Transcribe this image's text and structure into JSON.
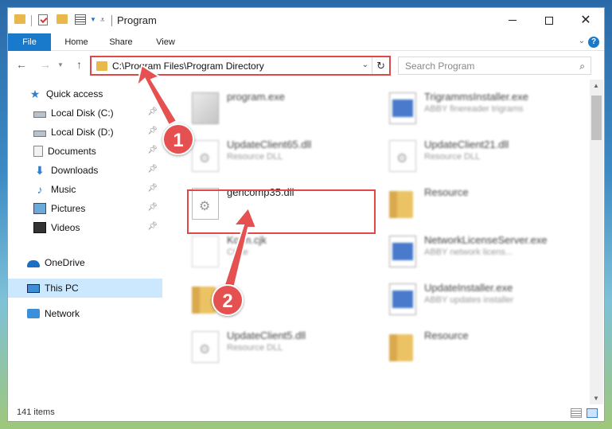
{
  "window": {
    "title": "Program"
  },
  "ribbon": {
    "tabs": [
      "File",
      "Home",
      "Share",
      "View"
    ],
    "help": "?"
  },
  "address": {
    "path": "C:\\Program Files\\Program Directory"
  },
  "search": {
    "placeholder": "Search Program"
  },
  "sidebar": {
    "items": [
      {
        "label": "Quick access",
        "icon": "star-icon"
      },
      {
        "label": "Local Disk (C:)",
        "icon": "disk-icon",
        "pinned": true
      },
      {
        "label": "Local Disk (D:)",
        "icon": "disk-icon",
        "pinned": true
      },
      {
        "label": "Documents",
        "icon": "documents-icon",
        "pinned": true
      },
      {
        "label": "Downloads",
        "icon": "downloads-icon",
        "pinned": true
      },
      {
        "label": "Music",
        "icon": "music-icon",
        "pinned": true
      },
      {
        "label": "Pictures",
        "icon": "pictures-icon",
        "pinned": true
      },
      {
        "label": "Videos",
        "icon": "videos-icon",
        "pinned": true
      },
      {
        "label": "OneDrive",
        "icon": "cloud-icon"
      },
      {
        "label": "This PC",
        "icon": "pc-icon",
        "selected": true
      },
      {
        "label": "Network",
        "icon": "network-icon"
      }
    ]
  },
  "files": [
    {
      "name": "program.exe",
      "desc": "",
      "icon": "installer-icon"
    },
    {
      "name": "TrigrammsInstaller.exe",
      "desc": "ABBY finereader trigrams",
      "icon": "exe-icon"
    },
    {
      "name": "UpdateClient65.dll",
      "desc": "Resource DLL",
      "icon": "dll-icon"
    },
    {
      "name": "UpdateClient21.dll",
      "desc": "Resource DLL",
      "icon": "dll-icon"
    },
    {
      "name": "gencomp35.dll",
      "desc": "",
      "icon": "dll-icon"
    },
    {
      "name": "Resource",
      "desc": "",
      "icon": "folder-icon"
    },
    {
      "name": "Ko    m.cjk",
      "desc": "CK   le",
      "icon": "file-icon"
    },
    {
      "name": "NetworkLicenseServer.exe",
      "desc": "ABBY network licens...",
      "icon": "exe-icon"
    },
    {
      "name": "",
      "desc": "",
      "icon": "folder-icon"
    },
    {
      "name": "UpdateInstaller.exe",
      "desc": "ABBY updates installer",
      "icon": "exe-icon"
    },
    {
      "name": "UpdateClient5.dll",
      "desc": "Resource DLL",
      "icon": "dll-icon"
    },
    {
      "name": "Resource",
      "desc": "",
      "icon": "folder-icon"
    }
  ],
  "status": {
    "count": "141 items"
  },
  "annotations": {
    "step1": "1",
    "step2": "2"
  }
}
